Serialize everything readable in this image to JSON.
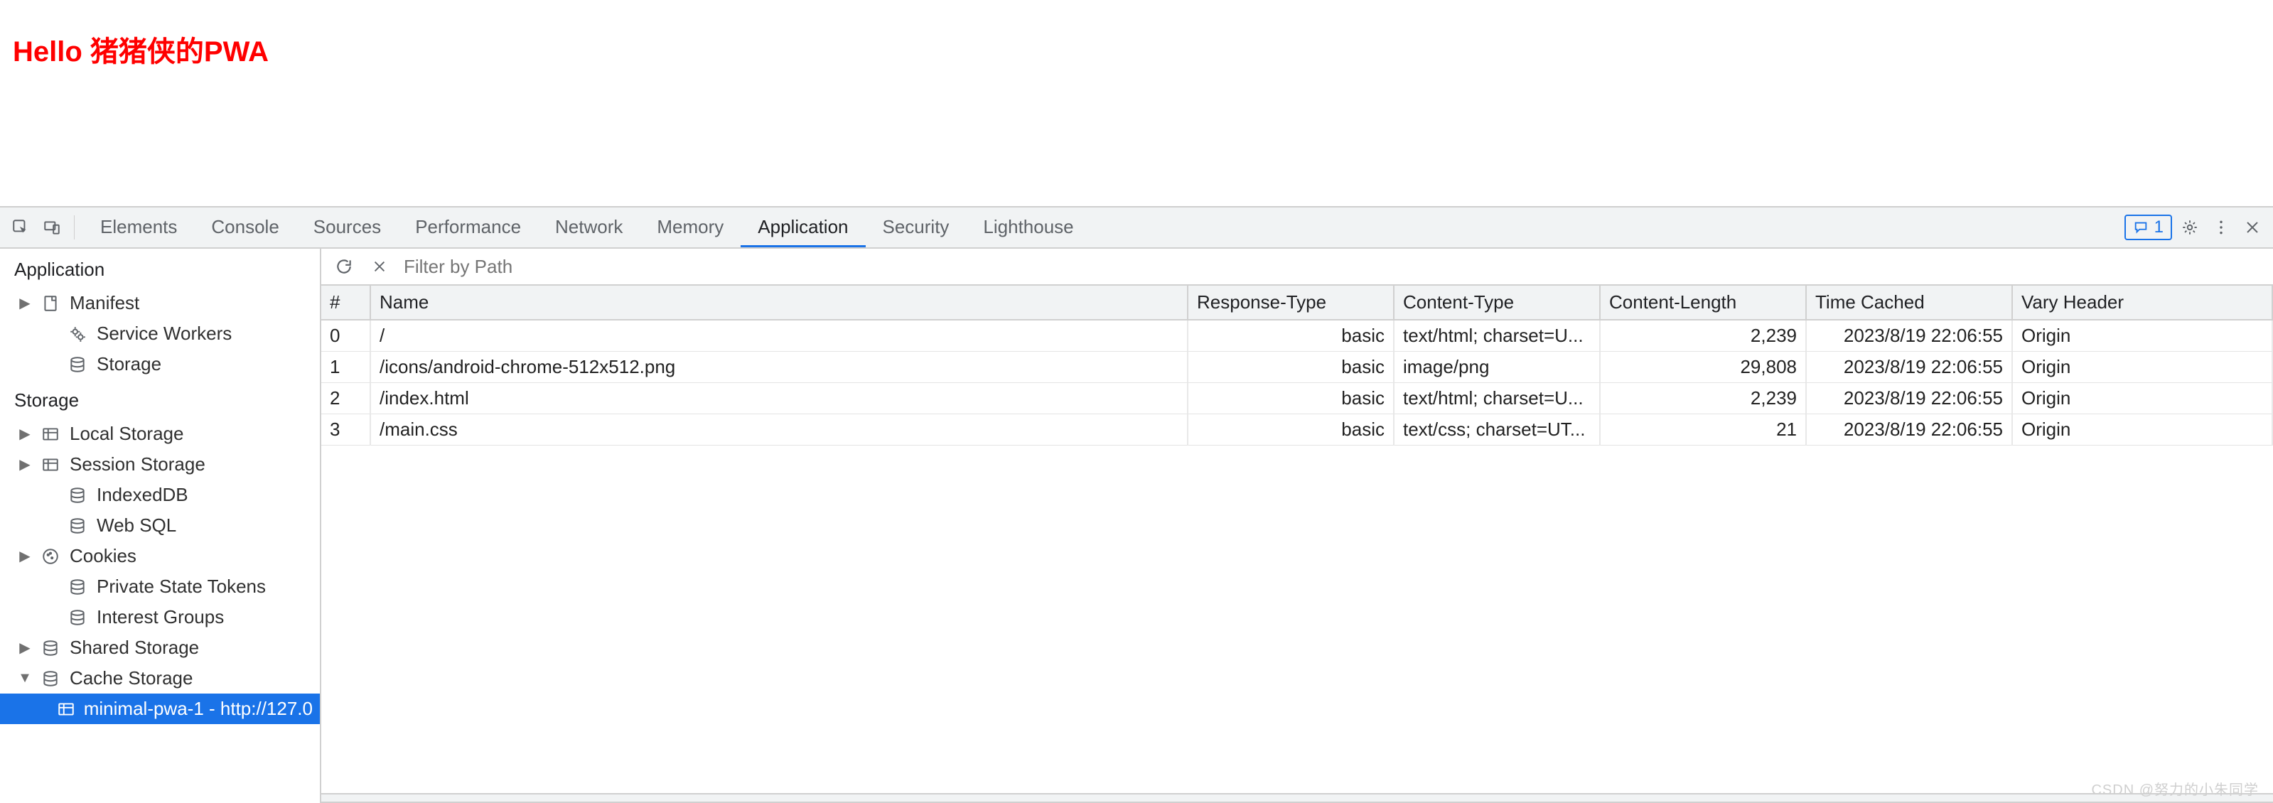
{
  "page": {
    "heading": "Hello 猪猪侠的PWA"
  },
  "tabs": {
    "items": [
      "Elements",
      "Console",
      "Sources",
      "Performance",
      "Network",
      "Memory",
      "Application",
      "Security",
      "Lighthouse"
    ],
    "active_index": 6
  },
  "issues_badge": {
    "count": "1"
  },
  "sidebar": {
    "sections": [
      {
        "title": "Application",
        "items": [
          {
            "label": "Manifest",
            "icon": "file",
            "expandable": true
          },
          {
            "label": "Service Workers",
            "icon": "gears",
            "indent": 1
          },
          {
            "label": "Storage",
            "icon": "db",
            "indent": 1
          }
        ]
      },
      {
        "title": "Storage",
        "items": [
          {
            "label": "Local Storage",
            "icon": "table",
            "expandable": true
          },
          {
            "label": "Session Storage",
            "icon": "table",
            "expandable": true
          },
          {
            "label": "IndexedDB",
            "icon": "db",
            "indent": 1
          },
          {
            "label": "Web SQL",
            "icon": "db",
            "indent": 1
          },
          {
            "label": "Cookies",
            "icon": "cookie",
            "expandable": true
          },
          {
            "label": "Private State Tokens",
            "icon": "db",
            "indent": 1
          },
          {
            "label": "Interest Groups",
            "icon": "db",
            "indent": 1
          },
          {
            "label": "Shared Storage",
            "icon": "db",
            "expandable": true
          },
          {
            "label": "Cache Storage",
            "icon": "db",
            "expanded": true
          },
          {
            "label": "minimal-pwa-1 - http://127.0",
            "icon": "table",
            "indent": 2,
            "selected": true
          }
        ]
      }
    ]
  },
  "toolbar": {
    "filter_placeholder": "Filter by Path"
  },
  "table": {
    "columns": [
      "#",
      "Name",
      "Response-Type",
      "Content-Type",
      "Content-Length",
      "Time Cached",
      "Vary Header"
    ],
    "rows": [
      {
        "idx": "0",
        "name": "/",
        "rtype": "basic",
        "ctype": "text/html; charset=U...",
        "clen": "2,239",
        "time": "2023/8/19 22:06:55",
        "vary": "Origin"
      },
      {
        "idx": "1",
        "name": "/icons/android-chrome-512x512.png",
        "rtype": "basic",
        "ctype": "image/png",
        "clen": "29,808",
        "time": "2023/8/19 22:06:55",
        "vary": "Origin"
      },
      {
        "idx": "2",
        "name": "/index.html",
        "rtype": "basic",
        "ctype": "text/html; charset=U...",
        "clen": "2,239",
        "time": "2023/8/19 22:06:55",
        "vary": "Origin"
      },
      {
        "idx": "3",
        "name": "/main.css",
        "rtype": "basic",
        "ctype": "text/css; charset=UT...",
        "clen": "21",
        "time": "2023/8/19 22:06:55",
        "vary": "Origin"
      }
    ]
  },
  "watermark": "CSDN @努力的小朱同学"
}
